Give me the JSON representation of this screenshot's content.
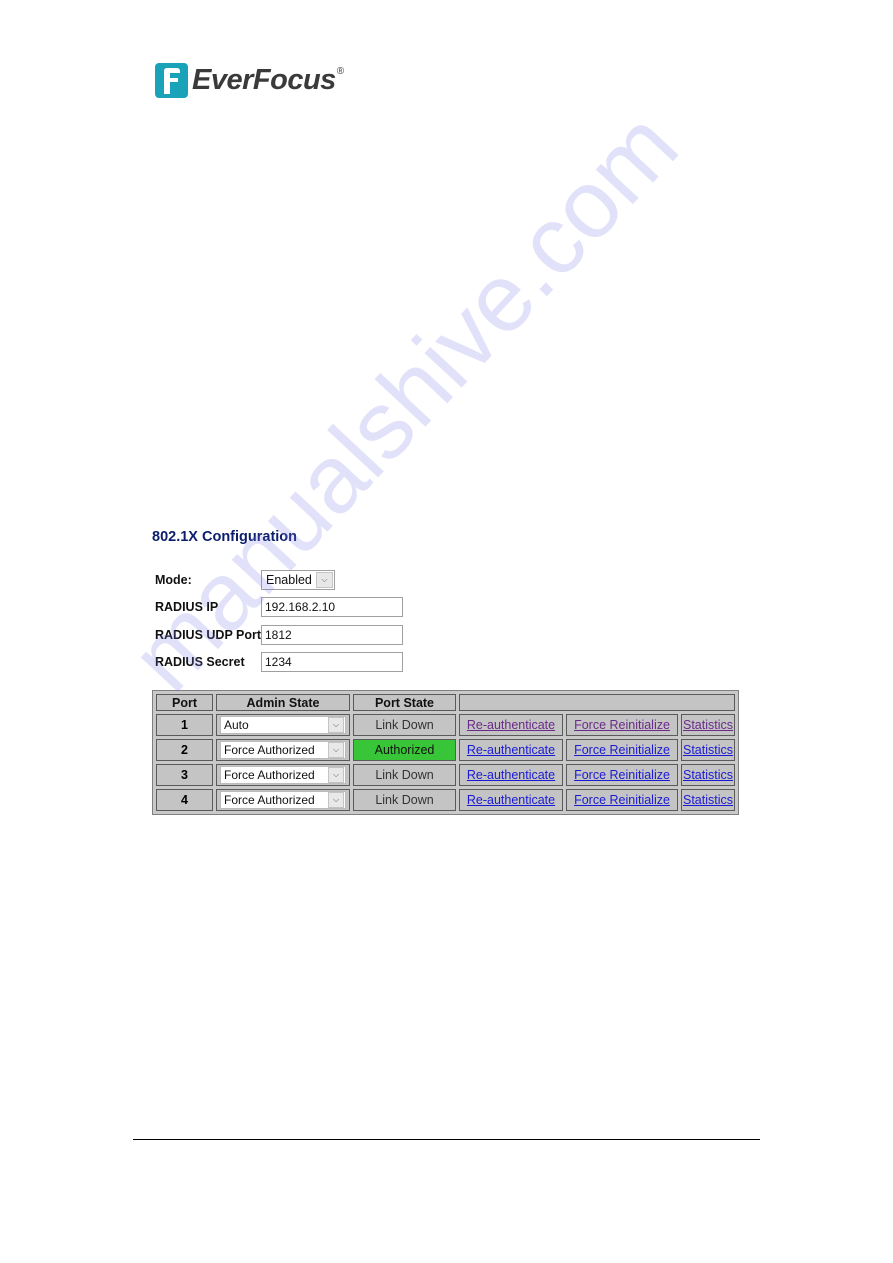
{
  "brand": {
    "name": "EverFocus",
    "registered": "®",
    "color": "#1aa3b8"
  },
  "page_title": "802.1X Configuration",
  "form": {
    "mode": {
      "label": "Mode:",
      "value": "Enabled"
    },
    "radius_ip": {
      "label": "RADIUS IP",
      "value": "192.168.2.10"
    },
    "radius_udp_port": {
      "label": "RADIUS UDP Port",
      "value": "1812"
    },
    "radius_secret": {
      "label": "RADIUS Secret",
      "value": "1234"
    }
  },
  "table": {
    "headers": [
      "Port",
      "Admin State",
      "Port State",
      ""
    ],
    "rows": [
      {
        "port": "1",
        "admin_state": "Auto",
        "port_state": "Link Down",
        "authorized": false,
        "reauth": "Re-authenticate",
        "reinit": "Force Reinitialize",
        "stats": "Statistics",
        "visited": true
      },
      {
        "port": "2",
        "admin_state": "Force Authorized",
        "port_state": "Authorized",
        "authorized": true,
        "reauth": "Re-authenticate",
        "reinit": "Force Reinitialize",
        "stats": "Statistics",
        "visited": false
      },
      {
        "port": "3",
        "admin_state": "Force Authorized",
        "port_state": "Link Down",
        "authorized": false,
        "reauth": "Re-authenticate",
        "reinit": "Force Reinitialize",
        "stats": "Statistics",
        "visited": false
      },
      {
        "port": "4",
        "admin_state": "Force Authorized",
        "port_state": "Link Down",
        "authorized": false,
        "reauth": "Re-authenticate",
        "reinit": "Force Reinitialize",
        "stats": "Statistics",
        "visited": false
      }
    ],
    "colors": {
      "authorized": "#38c638",
      "link": "#1a1ad4",
      "visited_link": "#6a2a8a"
    }
  },
  "watermark": "manualshive.com"
}
